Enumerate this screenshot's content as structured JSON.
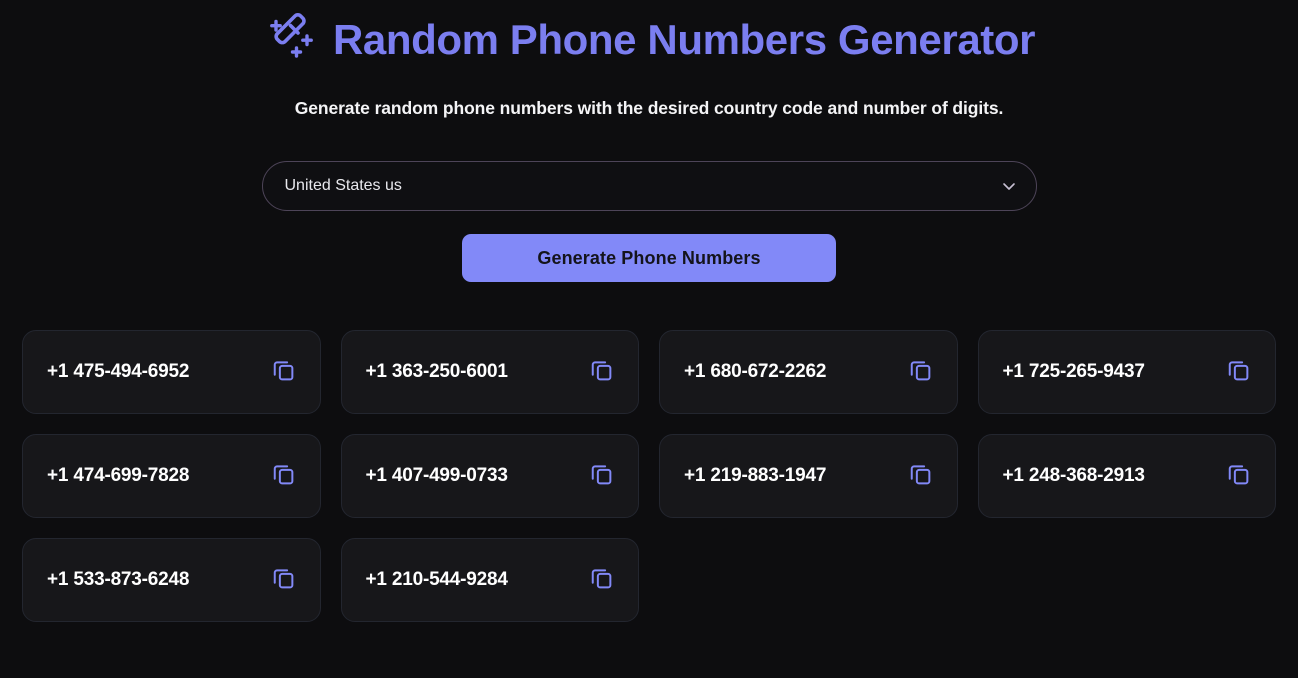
{
  "header": {
    "icon": "magic-wand-icon",
    "title": "Random Phone Numbers Generator",
    "subtitle": "Generate random phone numbers with the desired country code and number of digits."
  },
  "controls": {
    "country_select": {
      "icon": "chevron-down-icon",
      "selected": "United States us",
      "options": [
        "United States us"
      ]
    },
    "generate_button": {
      "label": "Generate Phone Numbers"
    }
  },
  "results": {
    "copy_icon": "copy-icon",
    "items": [
      {
        "number": "+1 475-494-6952"
      },
      {
        "number": "+1 363-250-6001"
      },
      {
        "number": "+1 680-672-2262"
      },
      {
        "number": "+1 725-265-9437"
      },
      {
        "number": "+1 474-699-7828"
      },
      {
        "number": "+1 407-499-0733"
      },
      {
        "number": "+1 219-883-1947"
      },
      {
        "number": "+1 248-368-2913"
      },
      {
        "number": "+1 533-873-6248"
      },
      {
        "number": "+1 210-544-9284"
      }
    ]
  },
  "colors": {
    "background": "#0d0d0f",
    "accent": "#7b7ef0",
    "button": "#8289f8",
    "card_background": "#17171a",
    "card_border": "#23262f",
    "select_border": "#4d4458",
    "text": "#ffffff"
  }
}
